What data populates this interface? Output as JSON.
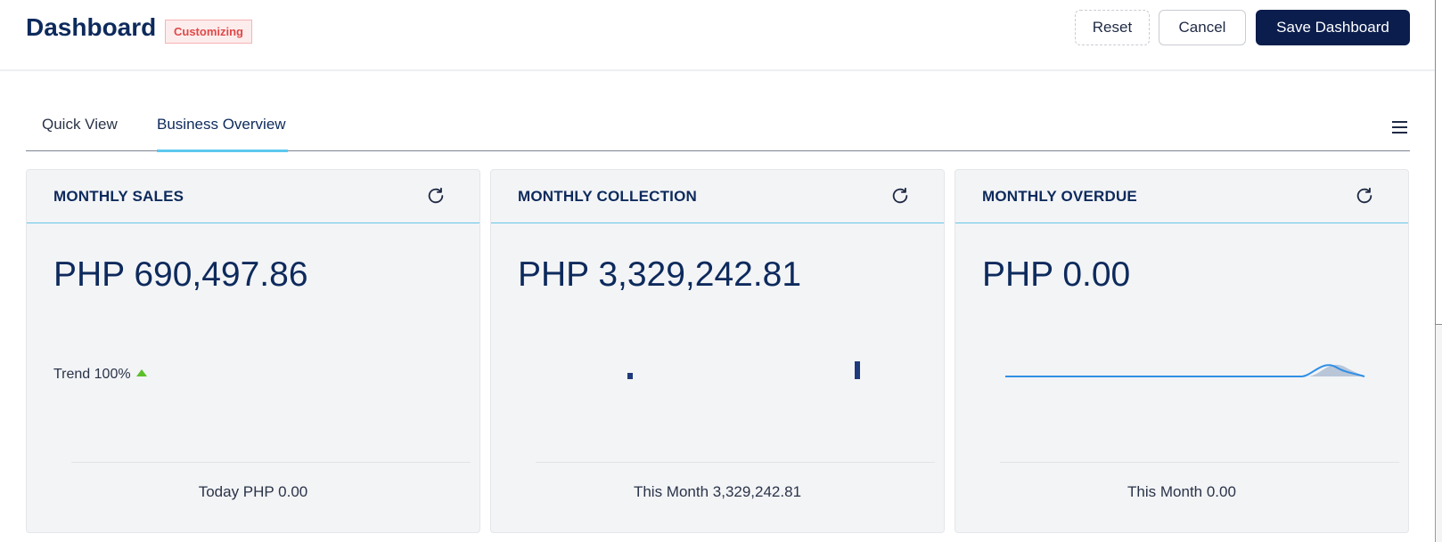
{
  "header": {
    "title": "Dashboard",
    "badge": "Customizing",
    "reset_label": "Reset",
    "cancel_label": "Cancel",
    "save_label": "Save Dashboard"
  },
  "tabs": [
    {
      "label": "Quick View",
      "active": false
    },
    {
      "label": "Business Overview",
      "active": true
    }
  ],
  "cards": [
    {
      "title": "MONTHLY SALES",
      "value": "PHP 690,497.86",
      "trend": "Trend 100%",
      "footer": "Today PHP 0.00"
    },
    {
      "title": "MONTHLY COLLECTION",
      "value": "PHP 3,329,242.81",
      "footer": "This Month 3,329,242.81",
      "bars": [
        0.35,
        1.0
      ]
    },
    {
      "title": "MONTHLY OVERDUE",
      "value": "PHP 0.00",
      "footer": "This Month 0.00"
    }
  ],
  "colors": {
    "brand_navy": "#0d2a5c",
    "accent_cyan": "#5cc8ef",
    "trend_up_green": "#5cbf2a",
    "badge_red": "#e04848",
    "spark_blue": "#2f8fe6"
  },
  "icons": {
    "refresh": "refresh-icon",
    "menu": "hamburger-menu-icon",
    "trend": "triangle-up-icon"
  }
}
